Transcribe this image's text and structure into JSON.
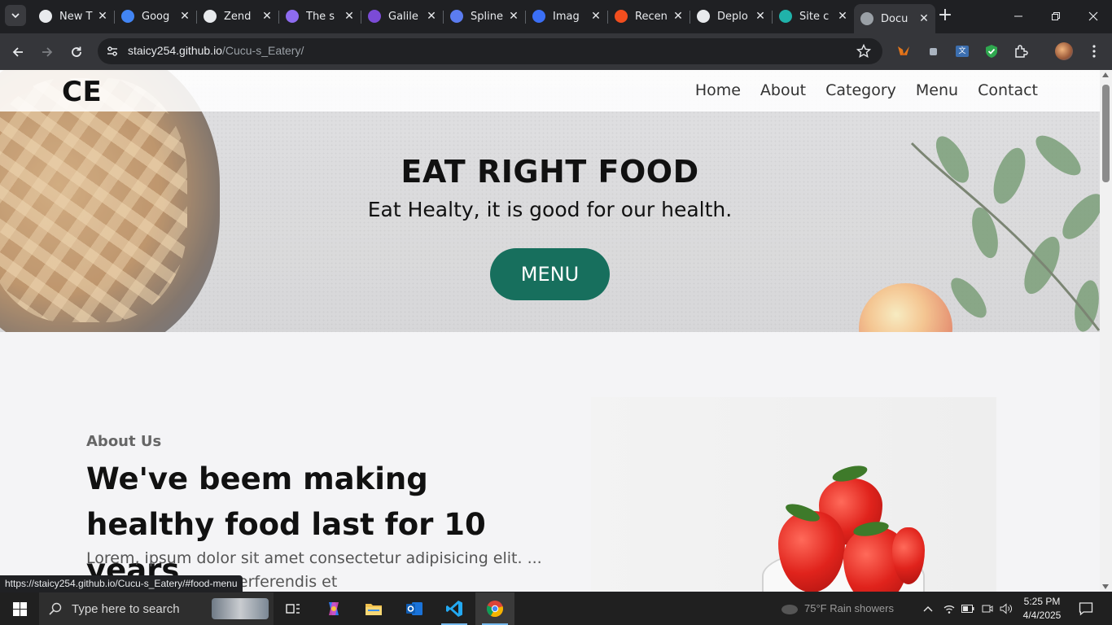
{
  "browser": {
    "tabs": [
      {
        "title": "New T",
        "favicon_color": "#e8eaed"
      },
      {
        "title": "Goog",
        "favicon_color": "#4285f4"
      },
      {
        "title": "Zend",
        "favicon_color": "#e8eaed"
      },
      {
        "title": "The s",
        "favicon_color": "#8e6cf0"
      },
      {
        "title": "Galile",
        "favicon_color": "#7b4bd6"
      },
      {
        "title": "Spline",
        "favicon_color": "#5b7cf0"
      },
      {
        "title": "Imag",
        "favicon_color": "#3b6ff5"
      },
      {
        "title": "Recen",
        "favicon_color": "#f24e1e"
      },
      {
        "title": "Deplo",
        "favicon_color": "#e8eaed"
      },
      {
        "title": "Site c",
        "favicon_color": "#20b2aa"
      },
      {
        "title": "Docu",
        "favicon_color": "#9aa0a6"
      }
    ],
    "active_tab_index": 10,
    "url_host": "staicy254.github.io",
    "url_path": "/Cucu-s_Eatery/",
    "status_url": "https://staicy254.github.io/Cucu-s_Eatery/#food-menu"
  },
  "site": {
    "logo": "CE",
    "nav": [
      "Home",
      "About",
      "Category",
      "Menu",
      "Contact"
    ],
    "hero": {
      "title": "EAT RIGHT FOOD",
      "subtitle": "Eat Healty, it is good for our health.",
      "button": "MENU",
      "button_color": "#176f5d"
    },
    "about": {
      "eyebrow": "About Us",
      "heading": "We've beem making healthy food last for 10 years",
      "paragraph": "Lorem, ipsum dolor sit amet consectetur adipisicing elit. ... nobis dignissimos perferendis et"
    }
  },
  "taskbar": {
    "search_placeholder": "Type here to search",
    "weather": "75°F  Rain showers",
    "time": "5:25 PM",
    "date": "4/4/2025"
  }
}
